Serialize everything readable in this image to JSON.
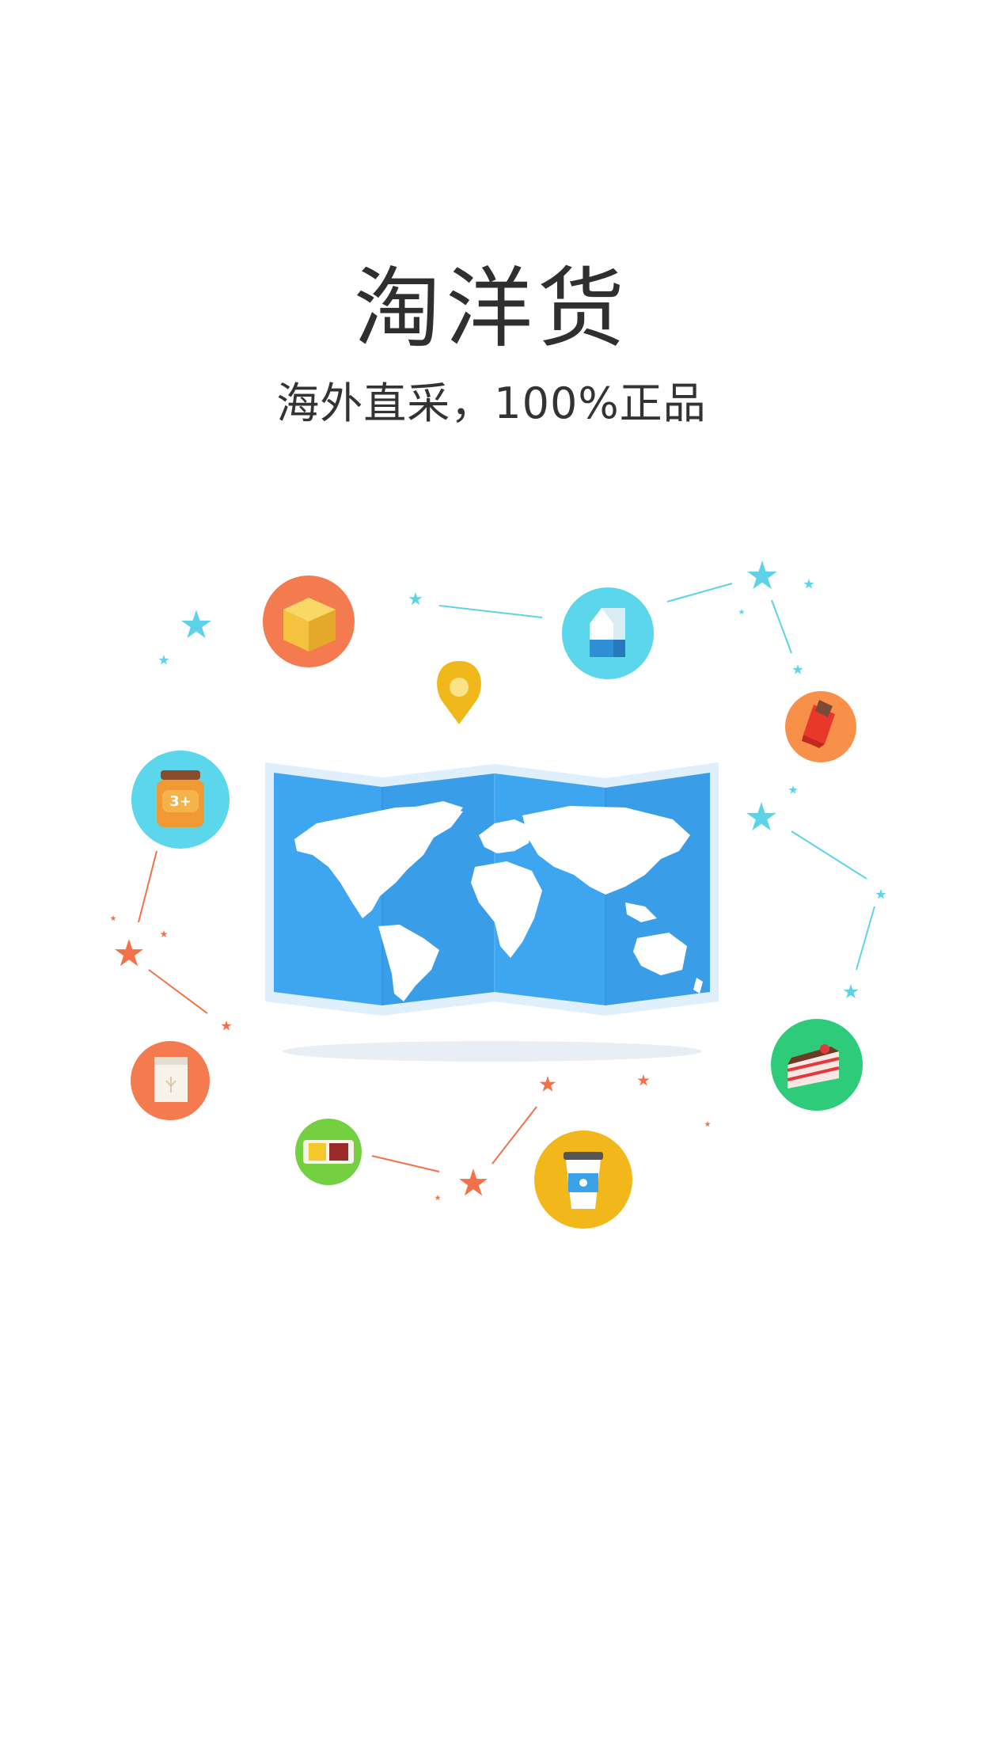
{
  "app": {
    "title": "淘洋货",
    "subtitle": "海外直采，100%正品"
  },
  "colors": {
    "map_blue": "#3ea6f1",
    "map_border": "#dfeffc",
    "pin_yellow": "#f1b81c",
    "star_cyan": "#5dd3e8",
    "star_orange": "#f37148",
    "badge_orange": "#f37b4f",
    "badge_cyan": "#5bd6ea",
    "badge_green": "#2ecc7a",
    "badge_lime": "#74d040",
    "badge_yellow": "#f2b81b"
  },
  "icons": [
    "box-icon",
    "milk-carton-icon",
    "chocolate-icon",
    "jar-icon",
    "milk-powder-bag-icon",
    "cake-icon",
    "coffee-cup-icon",
    "snack-icon",
    "location-pin-icon",
    "world-map-icon"
  ]
}
